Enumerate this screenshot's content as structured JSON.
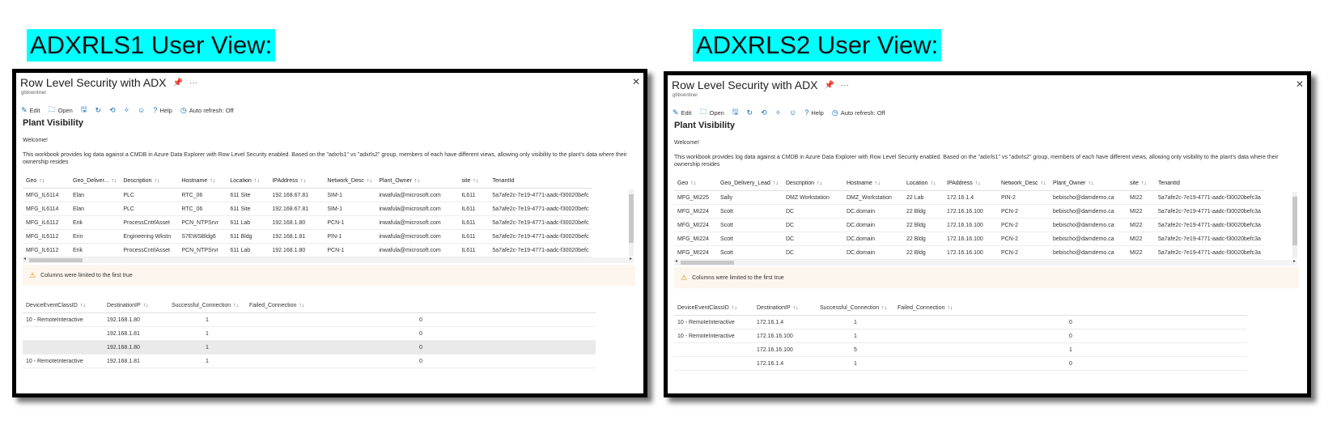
{
  "headings": {
    "left": "ADXRLS1 User View:",
    "right": "ADXRLS2 User View:"
  },
  "views": [
    {
      "title": "Row Level Security with ADX",
      "subtitle": "gbbsentinel",
      "toolbar": {
        "edit": "Edit",
        "open": "Open",
        "help": "Help",
        "auto_refresh": "Auto refresh: Off"
      },
      "section_title": "Plant Visibility",
      "welcome": "Welcome!",
      "description": "This workbook provides log data against a CMDB in Azure Data Explorer with Row Level Security enabled. Based on the \"adxrls1\" vs \"adxrls2\" group, members of each have different views, allowing only visibility to the plant's data where their ownership resides",
      "columns": [
        "Geo",
        "Geo_Deliver...",
        "Description",
        "Hostname",
        "Location",
        "IPAddress",
        "Network_Desc",
        "Plant_Owner",
        "site",
        "TenantId"
      ],
      "rows": [
        [
          "MFG_IL6114",
          "Elan",
          "PLC",
          "RTC_06",
          "611 Site",
          "192.168.67.81",
          "SIM-1",
          "inwafula@microsoft.com",
          "IL611",
          "5a7afe2c-7e19-4771-aadc-f30020befc"
        ],
        [
          "MFG_IL6114",
          "Elan",
          "PLC",
          "RTC_06",
          "611 Site",
          "192.168.67.81",
          "SIM-1",
          "inwafula@microsoft.com",
          "IL611",
          "5a7afe2c-7e19-4771-aadc-f30020befc"
        ],
        [
          "MFG_IL6112",
          "Erik",
          "ProcessCntrlAsset",
          "PCN_NTPSrvr",
          "611 Lab",
          "192.168.1.80",
          "PCN-1",
          "inwafula@microsoft.com",
          "IL611",
          "5a7afe2c-7e19-4771-aadc-f30020befc"
        ],
        [
          "MFG_IL6112",
          "Erin",
          "Engineering Wkstn",
          "S7EWSBldg6",
          "611 Bldg",
          "192.168.1.81",
          "PIN-1",
          "inwafula@microsoft.com",
          "IL611",
          "5a7afe2c-7e19-4771-aadc-f30020befc"
        ],
        [
          "MFG_IL6112",
          "Erik",
          "ProcessCntrlAsset",
          "PCN_NTPSrvr",
          "611 Lab",
          "192.168.1.80",
          "PCN-1",
          "inwafula@microsoft.com",
          "IL611",
          "5a7afe2c-7e19-4771-aadc-f30020befc"
        ]
      ],
      "warning": "Columns were limited to the first true",
      "conn_columns": [
        "DeviceEventClassID",
        "DestinationIP",
        "Successful_Connection",
        "Failed_Connection"
      ],
      "conn_rows": [
        [
          "10 - RemoteInteractive",
          "192.168.1.80",
          "1",
          "0"
        ],
        [
          "",
          "192.168.1.81",
          "1",
          "0"
        ],
        [
          "",
          "192.168.1.80",
          "1",
          "0"
        ],
        [
          "10 - RemoteInteractive",
          "192.168.1.81",
          "1",
          "0"
        ]
      ]
    },
    {
      "title": "Row Level Security with ADX",
      "subtitle": "gbbsentinel",
      "toolbar": {
        "edit": "Edit",
        "open": "Open",
        "help": "Help",
        "auto_refresh": "Auto refresh: Off"
      },
      "section_title": "Plant Visibility",
      "welcome": "Welcome!",
      "description": "This workbook provides log data against a CMDB in Azure Data Explorer with Row Level Security enabled. Based on the \"adxrls1\" vs \"adxrls2\" group, members of each have different views, allowing only visibility to the plant's data where their ownership resides",
      "columns": [
        "Geo",
        "Geo_Delivery_Lead",
        "Description",
        "Hostname",
        "Location",
        "IPAddress",
        "Network_Desc",
        "Plant_Owner",
        "site",
        "TenantId"
      ],
      "rows": [
        [
          "MFG_MI225",
          "Sally",
          "DMZ Workstation",
          "DMZ_Workstation",
          "22 Lab",
          "172.16.1.4",
          "PIN-2",
          "bebischo@damdemo.ca",
          "MI22",
          "5a7afe2c-7e19-4771-aadc-f30020befc3a"
        ],
        [
          "MFG_MI224",
          "Scott",
          "DC",
          "DC.domain",
          "22 Bldg",
          "172.16.16.100",
          "PCN-2",
          "bebischo@damdemo.ca",
          "MI22",
          "5a7afe2c-7e19-4771-aadc-f30020befc3a"
        ],
        [
          "MFG_MI224",
          "Scott",
          "DC",
          "DC.domain",
          "22 Bldg",
          "172.16.16.100",
          "PCN-2",
          "bebischo@damdemo.ca",
          "MI22",
          "5a7afe2c-7e19-4771-aadc-f30020befc3a"
        ],
        [
          "MFG_MI224",
          "Scott",
          "DC",
          "DC.domain",
          "22 Bldg",
          "172.16.16.100",
          "PCN-2",
          "bebischo@damdemo.ca",
          "MI22",
          "5a7afe2c-7e19-4771-aadc-f30020befc3a"
        ],
        [
          "MFG_MI224",
          "Scott",
          "DC",
          "DC.domain",
          "22 Bldg",
          "172.16.16.100",
          "PCN-2",
          "bebischo@damdemo.ca",
          "MI22",
          "5a7afe2c-7e19-4771-aadc-f30020befc3a"
        ]
      ],
      "warning": "Columns were limited to the first true",
      "conn_columns": [
        "DeviceEventClassID",
        "DestinationIP",
        "Successful_Connection",
        "Failed_Connection"
      ],
      "conn_rows": [
        [
          "10 - RemoteInteractive",
          "172.16.1.4",
          "1",
          "0"
        ],
        [
          "10 - RemoteInteractive",
          "172.16.16.100",
          "1",
          "0"
        ],
        [
          "",
          "172.16.16.100",
          "5",
          "1"
        ],
        [
          "",
          "172.16.1.4",
          "1",
          "0"
        ]
      ]
    }
  ]
}
